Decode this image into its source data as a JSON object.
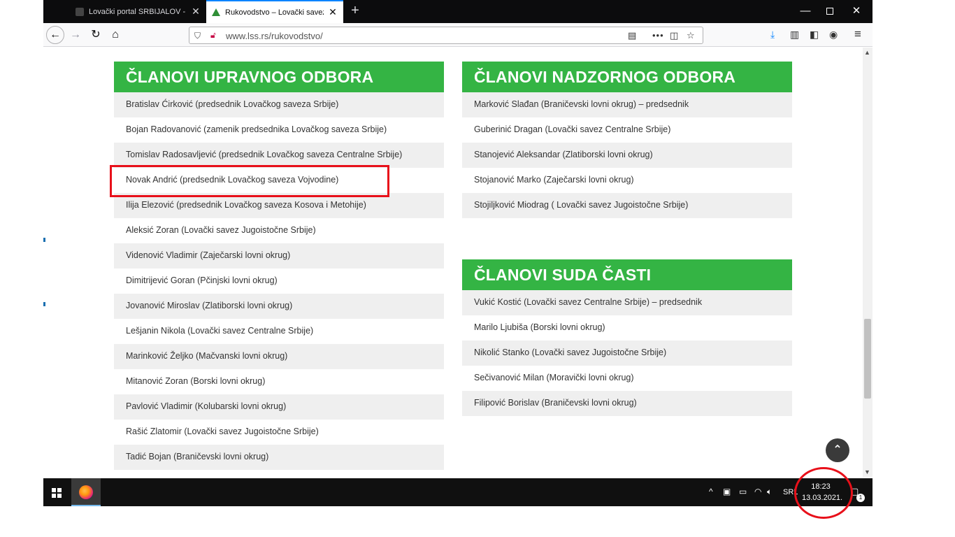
{
  "browser": {
    "tabs": [
      {
        "title": "Lovački portal SRBIJALOV - Ad"
      },
      {
        "title": "Rukovodstvo – Lovački savez Sr"
      }
    ],
    "new_tab_label": "+",
    "url": "www.lss.rs/rukovodstvo/",
    "window_controls": {
      "minimize": "—",
      "close": "✕"
    }
  },
  "page": {
    "upravni": {
      "title": "ČLANOVI UPRAVNOG ODBORA",
      "members": [
        "Bratislav Ćirković (predsednik Lovačkog saveza Srbije)",
        "Bojan Radovanović (zamenik predsednika Lovačkog saveza Srbije)",
        "Tomislav Radosavljević (predsednik Lovačkog saveza Centralne Srbije)",
        "Novak Andrić (predsednik Lovačkog saveza Vojvodine)",
        "Ilija Elezović (predsednik Lovačkog saveza Kosova i Metohije)",
        "Aleksić Zoran (Lovački savez Jugoistočne Srbije)",
        "Videnović Vladimir (Zaječarski lovni okrug)",
        "Dimitrijević Goran (Pčinjski lovni okrug)",
        "Jovanović Miroslav (Zlatiborski lovni okrug)",
        "Lešjanin Nikola (Lovački savez Centralne Srbije)",
        "Marinković Željko (Mačvanski lovni okrug)",
        "Mitanović Zoran (Borski lovni okrug)",
        "Pavlović Vladimir (Kolubarski lovni okrug)",
        "Rašić Zlatomir (Lovački savez Jugoistočne Srbije)",
        "Tadić Bojan (Braničevski lovni okrug)"
      ]
    },
    "nadzorni": {
      "title": "ČLANOVI NADZORNOG ODBORA",
      "members": [
        "Marković Slađan (Braničevski lovni okrug) – predsednik",
        "Guberinić Dragan (Lovački savez Centralne Srbije)",
        "Stanojević Aleksandar (Zlatiborski lovni okrug)",
        "Stojanović Marko (Zaječarski lovni okrug)",
        "Stojiljković Miodrag ( Lovački savez Jugoistočne Srbije)"
      ]
    },
    "sud": {
      "title": "ČLANOVI SUDA ČASTI",
      "members": [
        "Vukić Kostić (Lovački savez Centralne Srbije) – predsednik",
        "Marilo Ljubiša (Borski lovni okrug)",
        "Nikolić Stanko (Lovački savez Jugoistočne Srbije)",
        "Sečivanović Milan (Moravički lovni okrug)",
        "Filipović Borislav (Braničevski lovni okrug)"
      ]
    },
    "scroll_top_label": "⌃"
  },
  "taskbar": {
    "language": "SRL",
    "time": "18:23",
    "date": "13.03.2021.",
    "notification_count": "1"
  },
  "colors": {
    "header_green": "#34b444",
    "annotation_red": "#e8101a"
  }
}
